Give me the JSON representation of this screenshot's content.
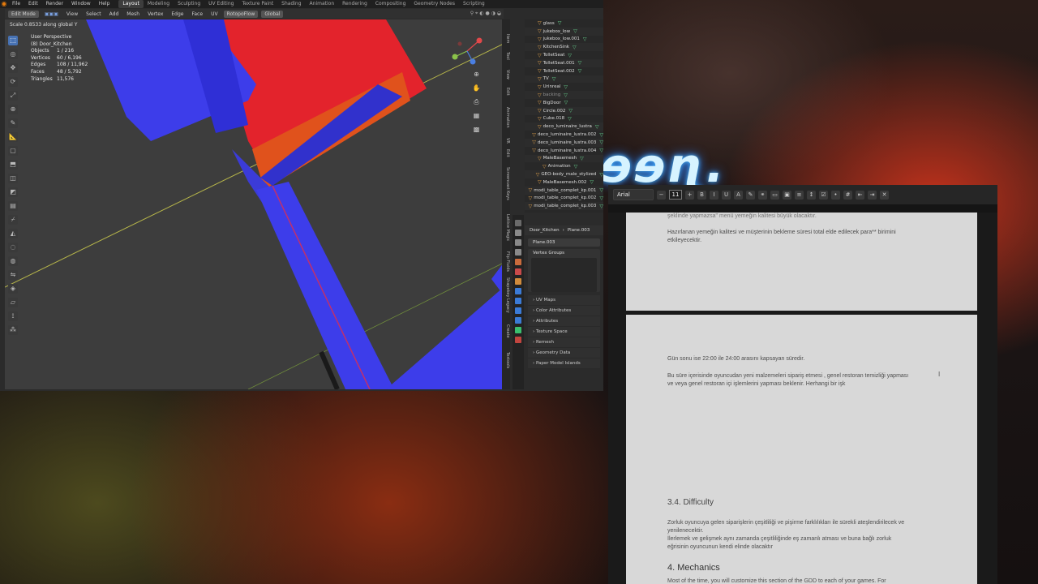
{
  "blender": {
    "menu": [
      "File",
      "Edit",
      "Render",
      "Window",
      "Help"
    ],
    "workspaces": [
      "Layout",
      "Modeling",
      "Sculpting",
      "UV Editing",
      "Texture Paint",
      "Shading",
      "Animation",
      "Rendering",
      "Compositing",
      "Geometry Nodes",
      "Scripting"
    ],
    "active_workspace": "Layout",
    "header": {
      "mode": "Edit Mode",
      "menus": [
        "View",
        "Select",
        "Add",
        "Mesh",
        "Vertex",
        "Edge",
        "Face",
        "UV"
      ],
      "tool_setting": "RotopoFlow",
      "orientation": "Global"
    },
    "scale_text": "Scale 0.8533 along global Y",
    "viewport": {
      "perspective": "User Perspective",
      "object_name": "(8) Door_Kitchen",
      "stats": [
        {
          "label": "Objects",
          "value": "1 / 216"
        },
        {
          "label": "Vertices",
          "value": "60 / 6,196"
        },
        {
          "label": "Edges",
          "value": "108 / 11,962"
        },
        {
          "label": "Faces",
          "value": "48 / 5,792"
        },
        {
          "label": "Triangles",
          "value": "11,576"
        }
      ]
    },
    "sidebar_tabs": [
      "Item",
      "Tool",
      "View",
      "Edit",
      "Animation",
      "VR",
      "Edit",
      "Screencast Keys",
      "Lattice Magic",
      "Flip Fluids",
      "Shapekey Legacy",
      "Create",
      "Textools"
    ],
    "outliner": [
      {
        "name": "glass",
        "dim": false
      },
      {
        "name": "jukebox_low",
        "dim": false
      },
      {
        "name": "jukebox_low.001",
        "dim": false
      },
      {
        "name": "KitchenSink",
        "dim": false
      },
      {
        "name": "TolletSeat",
        "dim": false
      },
      {
        "name": "TolletSeat.001",
        "dim": false
      },
      {
        "name": "TolletSeat.002",
        "dim": false
      },
      {
        "name": "TV",
        "dim": false
      },
      {
        "name": "Urinreal",
        "dim": false
      },
      {
        "name": "backing",
        "dim": true
      },
      {
        "name": "BigDoor",
        "dim": false
      },
      {
        "name": "Circle.002",
        "dim": false
      },
      {
        "name": "Cube.018",
        "dim": false
      },
      {
        "name": "deco_luminaire_lustra",
        "dim": false
      },
      {
        "name": "deco_luminaire_lustra.002",
        "dim": false
      },
      {
        "name": "deco_luminaire_lustra.003",
        "dim": false
      },
      {
        "name": "deco_luminaire_lustra.004",
        "dim": false
      },
      {
        "name": "MaleBasemesh",
        "dim": false
      },
      {
        "name": "Animation",
        "dim": false
      },
      {
        "name": "GEO-body_male_stylized",
        "dim": false
      },
      {
        "name": "MaleBasemesh.002",
        "dim": false
      },
      {
        "name": "modi_table_complet_kp.001",
        "dim": false
      },
      {
        "name": "modi_table_complet_kp.002",
        "dim": false
      },
      {
        "name": "modi_table_complet_kp.003",
        "dim": false
      }
    ],
    "properties": {
      "breadcrumb_object": "Door_Kitchen",
      "breadcrumb_mesh": "Plane.003",
      "mesh_name": "Plane.003",
      "vertex_groups": "Vertex Groups",
      "panels": [
        "UV Maps",
        "Color Attributes",
        "Attributes",
        "Texture Space",
        "Remesh",
        "Geometry Data",
        "Paper Model Islands"
      ]
    }
  },
  "doc": {
    "font": "Arial",
    "font_size": "11",
    "page1": {
      "cut_line": "şeklinde yapmazsa\" menü yemeğin kalitesi büyük olacaktır.",
      "para1": "Hazırlanan yemeğin kalitesi ve müşterinin bekleme süresi total elde edilecek para** birimini",
      "para1b": "etkileyecektir."
    },
    "page2": {
      "line1": "Gün sonu ise 22:00 ile 24:00 arasını kapsayan süredir.",
      "line2": "Bu süre içerisinde oyuncudan yeni malzemeleri sipariş etmesi , genel restoran temizliği yapması",
      "line3": "ve veya genel restoran içi işlemlerini yapması beklenir. Herhangi bir işk",
      "heading_difficulty": "3.4. Difficulty",
      "diff1": "Zorluk oyuncuya gelen siparişlerin çeşitliliği ve pişirme farklılıkları ile sürekli ateşlendirilecek ve",
      "diff2": "yenilenecektir.",
      "diff3": "İlerlemek ve gelişmek aynı zamanda çeşitliliğinde eş zamanlı atması ve buna bağlı zorluk",
      "diff4": "eğrisinin oyuncunun kendi elinde olacaktır",
      "heading_mechanics": "4. Mechanics",
      "mech1": "Most of the time, you will customize this section of the GDD to each of your games. For"
    }
  },
  "colors": {
    "blue": "#3d3dea",
    "red": "#e3232c",
    "orange": "#e0521c",
    "blender_accent": "#4772b3"
  }
}
